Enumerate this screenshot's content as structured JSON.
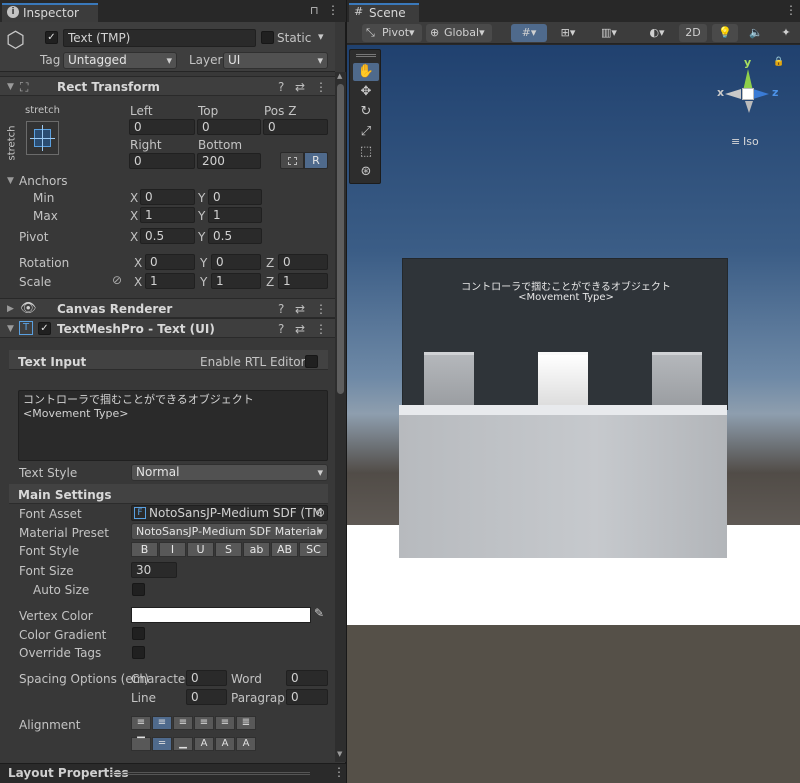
{
  "inspector": {
    "tab_label": "Inspector",
    "object_name": "Text (TMP)",
    "static_label": "Static",
    "tag_label": "Tag",
    "tag_value": "Untagged",
    "layer_label": "Layer",
    "layer_value": "UI"
  },
  "rect_transform": {
    "title": "Rect Transform",
    "stretch_label": "stretch",
    "left_label": "Left",
    "left_value": "0",
    "top_label": "Top",
    "top_value": "0",
    "posz_label": "Pos Z",
    "posz_value": "0",
    "right_label": "Right",
    "right_value": "0",
    "bottom_label": "Bottom",
    "bottom_value": "200",
    "r_button": "R",
    "anchors_label": "Anchors",
    "min_label": "Min",
    "min_x": "0",
    "min_y": "0",
    "max_label": "Max",
    "max_x": "1",
    "max_y": "1",
    "pivot_label": "Pivot",
    "pivot_x": "0.5",
    "pivot_y": "0.5",
    "rotation_label": "Rotation",
    "rot_x": "0",
    "rot_y": "0",
    "rot_z": "0",
    "scale_label": "Scale",
    "scale_x": "1",
    "scale_y": "1",
    "scale_z": "1",
    "x": "X",
    "y": "Y",
    "z": "Z"
  },
  "canvas_renderer": {
    "title": "Canvas Renderer"
  },
  "tmp": {
    "title": "TextMeshPro - Text (UI)",
    "text_input_label": "Text Input",
    "rtl_label": "Enable RTL Editor",
    "text_line1": "コントローラで掴むことができるオブジェクト",
    "text_line2": "<Movement Type>",
    "text_style_label": "Text Style",
    "text_style_value": "Normal",
    "main_settings_label": "Main Settings",
    "font_asset_label": "Font Asset",
    "font_asset_value": "NotoSansJP-Medium SDF (TM",
    "material_preset_label": "Material Preset",
    "material_preset_value": "NotoSansJP-Medium SDF Material",
    "font_style_label": "Font Style",
    "font_style_buttons": [
      "B",
      "I",
      "U",
      "S",
      "ab",
      "AB",
      "SC"
    ],
    "font_size_label": "Font Size",
    "font_size_value": "30",
    "auto_size_label": "Auto Size",
    "vertex_color_label": "Vertex Color",
    "color_gradient_label": "Color Gradient",
    "override_tags_label": "Override Tags",
    "spacing_label": "Spacing Options (em)",
    "character_label": "Character",
    "character_value": "0",
    "word_label": "Word",
    "word_value": "0",
    "line_label": "Line",
    "line_value": "0",
    "paragraph_label": "Paragraph",
    "paragraph_value": "0",
    "alignment_label": "Alignment"
  },
  "layout_properties": {
    "title": "Layout Properties"
  },
  "scene": {
    "tab_label": "Scene",
    "pivot_label": "Pivot",
    "global_label": "Global",
    "mode_2d": "2D",
    "gizmo_y": "y",
    "gizmo_z": "z",
    "gizmo_x": "x",
    "iso_label": "Iso",
    "panel_line1": "コントローラで掴むことができるオブジェクト",
    "panel_line2": "<Movement Type>"
  },
  "colors": {
    "accent": "#3d5d85",
    "panel_bg": "#383838",
    "scene_floor": "#ffffff"
  }
}
